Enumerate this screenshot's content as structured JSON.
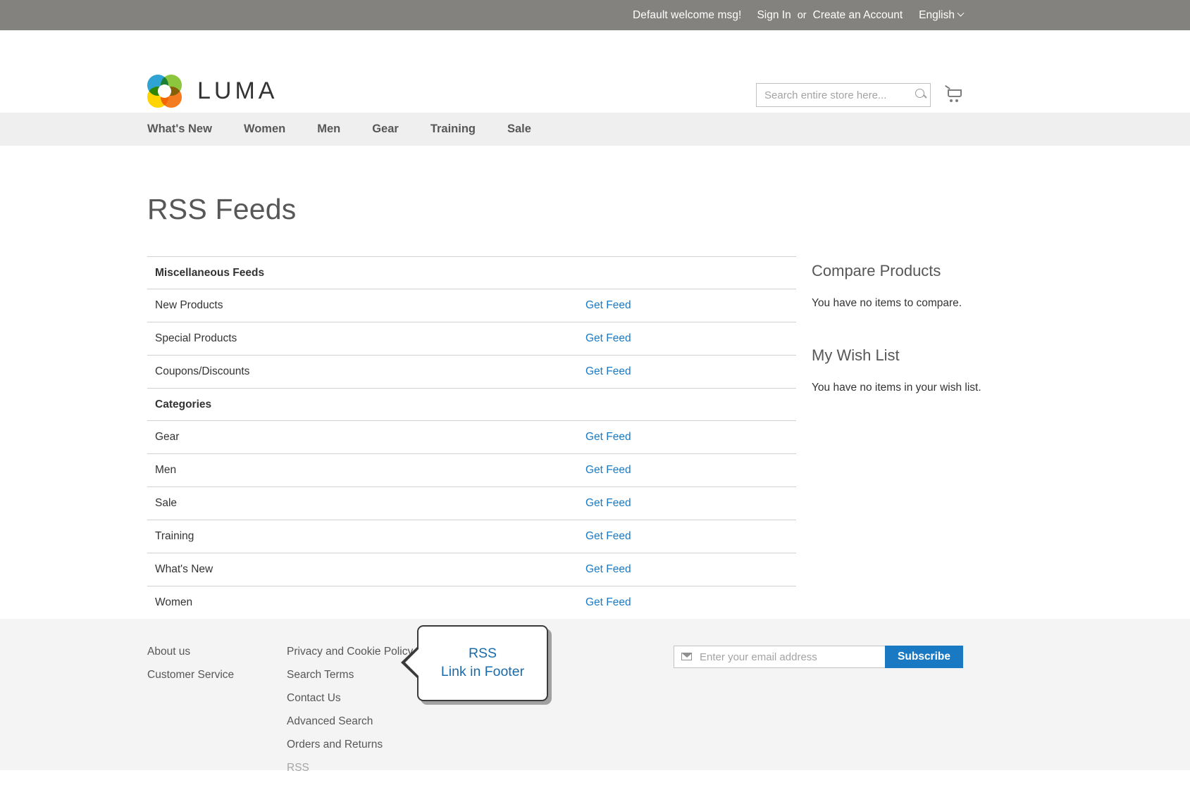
{
  "top_panel": {
    "welcome": "Default welcome msg!",
    "sign_in": "Sign In",
    "or": "or",
    "create_account": "Create an Account",
    "language": "English"
  },
  "header": {
    "logo_text": "LUMA",
    "search": {
      "placeholder": "Search entire store here...",
      "value": ""
    }
  },
  "nav": {
    "items": [
      {
        "label": "What's New"
      },
      {
        "label": "Women"
      },
      {
        "label": "Men"
      },
      {
        "label": "Gear"
      },
      {
        "label": "Training"
      },
      {
        "label": "Sale"
      }
    ]
  },
  "main": {
    "page_title": "RSS Feeds",
    "link_label": "Get Feed",
    "groups": [
      {
        "title": "Miscellaneous Feeds",
        "rows": [
          {
            "name": "New Products",
            "link": "Get Feed"
          },
          {
            "name": "Special Products",
            "link": "Get Feed"
          },
          {
            "name": "Coupons/Discounts",
            "link": "Get Feed"
          }
        ]
      },
      {
        "title": "Categories",
        "rows": [
          {
            "name": "Gear",
            "link": "Get Feed"
          },
          {
            "name": "Men",
            "link": "Get Feed"
          },
          {
            "name": "Sale",
            "link": "Get Feed"
          },
          {
            "name": "Training",
            "link": "Get Feed"
          },
          {
            "name": "What's New",
            "link": "Get Feed"
          },
          {
            "name": "Women",
            "link": "Get Feed"
          }
        ]
      }
    ]
  },
  "sidebar": {
    "compare": {
      "title": "Compare Products",
      "empty": "You have no items to compare."
    },
    "wishlist": {
      "title": "My Wish List",
      "empty": "You have no items in your wish list."
    }
  },
  "footer": {
    "col1": [
      {
        "label": "About us",
        "state": "active"
      },
      {
        "label": "Customer Service",
        "state": "active"
      }
    ],
    "col2": [
      {
        "label": "Privacy and Cookie Policy",
        "state": "active"
      },
      {
        "label": "Search Terms",
        "state": "active"
      },
      {
        "label": "Contact Us",
        "state": "active"
      },
      {
        "label": "Advanced Search",
        "state": "active"
      },
      {
        "label": "Orders and Returns",
        "state": "active"
      },
      {
        "label": "RSS",
        "state": "disabled"
      }
    ],
    "newsletter": {
      "placeholder": "Enter your email address",
      "value": "",
      "subscribe_label": "Subscribe"
    }
  },
  "callout": {
    "line1": "RSS",
    "line2": "Link in Footer"
  },
  "colors": {
    "top_panel_bg": "#84827f",
    "nav_bg": "#efefef",
    "footer_bg": "#f4f4f4",
    "link_blue": "#1979c3",
    "text_dark": "#333333",
    "text_muted": "#575757",
    "callout_text": "#1a6bab",
    "border": "#d1d1d1"
  }
}
